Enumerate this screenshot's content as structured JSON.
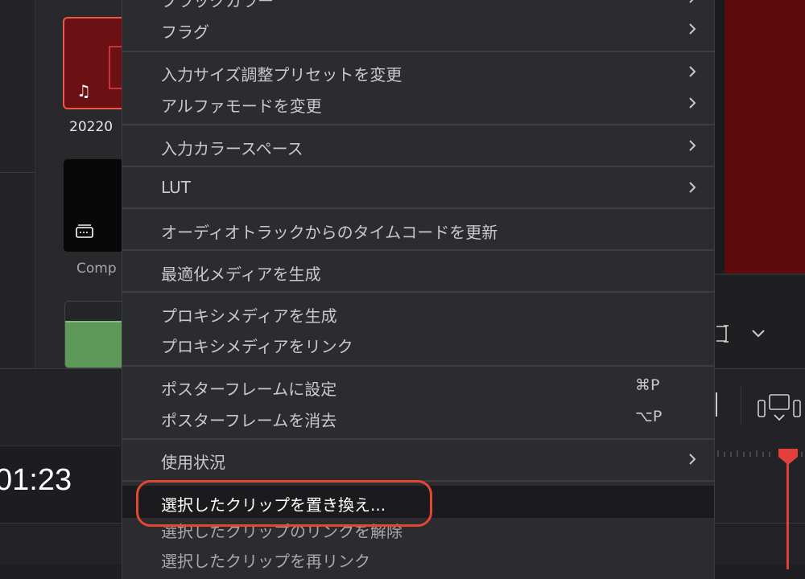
{
  "media_pool": {
    "clips": [
      {
        "label": "20220",
        "icon": "music-note-icon",
        "color": "#6b1114"
      },
      {
        "label": "Comp",
        "icon": "compound-clip-icon",
        "color": "#080808"
      },
      {
        "label": "",
        "icon": "audio-waveform",
        "color": "#5e9a57"
      }
    ]
  },
  "timeline": {
    "timecode": "01:23"
  },
  "context_menu": {
    "items": [
      {
        "label": "ブラックカラー",
        "has_submenu": true
      },
      {
        "label": "フラグ",
        "has_submenu": true
      },
      {
        "label": "入力サイズ調整プリセットを変更",
        "has_submenu": true
      },
      {
        "label": "アルファモードを変更",
        "has_submenu": true
      },
      {
        "label": "入力カラースペース",
        "has_submenu": true
      },
      {
        "label": "LUT",
        "has_submenu": true
      },
      {
        "label": "オーディオトラックからのタイムコードを更新",
        "has_submenu": false
      },
      {
        "label": "最適化メディアを生成",
        "has_submenu": false
      },
      {
        "label": "プロキシメディアを生成",
        "has_submenu": false
      },
      {
        "label": "プロキシメディアをリンク",
        "has_submenu": false
      },
      {
        "label": "ポスターフレームに設定",
        "shortcut": "⌘P"
      },
      {
        "label": "ポスターフレームを消去",
        "shortcut": "⌥P"
      },
      {
        "label": "使用状況",
        "has_submenu": true
      },
      {
        "label": "選択したクリップを置き換え...",
        "highlighted": true
      },
      {
        "label": "選択したクリップのリンクを解除",
        "has_submenu": false
      },
      {
        "label": "選択したクリップを再リンク",
        "has_submenu": false
      }
    ]
  },
  "colors": {
    "highlight_ring": "#e4472f",
    "playhead": "#e2413b",
    "viewer_clip": "#5c0a0a"
  }
}
